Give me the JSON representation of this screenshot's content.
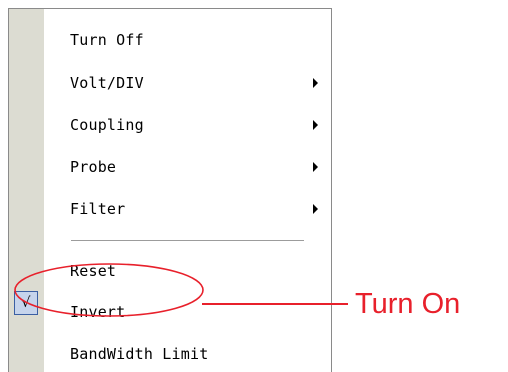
{
  "menu": {
    "items": [
      {
        "label": "Turn Off",
        "submenu": false
      },
      {
        "label": "Volt/DIV",
        "submenu": true
      },
      {
        "label": "Coupling",
        "submenu": true
      },
      {
        "label": "Probe",
        "submenu": true
      },
      {
        "label": "Filter",
        "submenu": true
      },
      {
        "label": "Reset",
        "submenu": false
      },
      {
        "label": "Invert",
        "submenu": false,
        "checked": true
      },
      {
        "label": "BandWidth Limit",
        "submenu": false
      }
    ],
    "check_glyph": "√"
  },
  "annotation": {
    "text": "Turn On",
    "color": "#e8202b"
  }
}
